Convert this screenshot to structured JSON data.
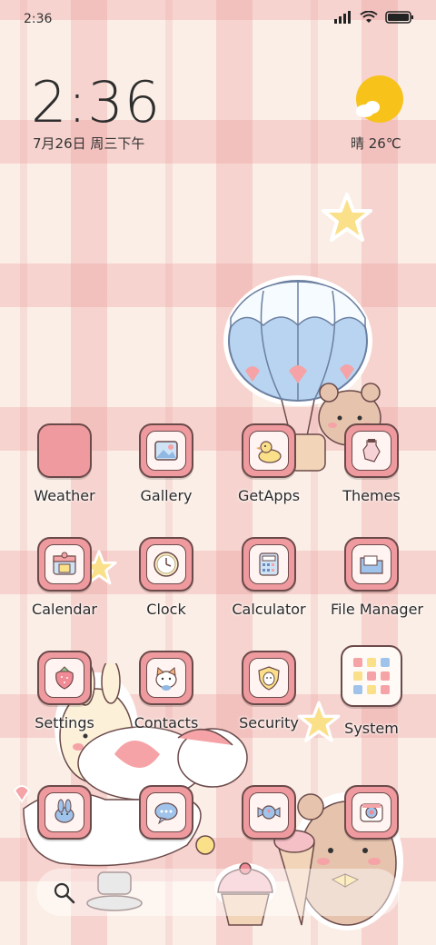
{
  "status_bar": {
    "time": "2:36",
    "icons": [
      "signal-icon",
      "wifi-icon",
      "battery-icon"
    ]
  },
  "clock_widget": {
    "time": "2:36",
    "date": "7月26日 周三下午"
  },
  "weather_widget": {
    "condition_icon": "sun-cloud-icon",
    "text": "晴 26℃"
  },
  "apps_row1": [
    {
      "label": "Weather",
      "icon": "weather-icon"
    },
    {
      "label": "Gallery",
      "icon": "picture-icon"
    },
    {
      "label": "GetApps",
      "icon": "duck-icon"
    },
    {
      "label": "Themes",
      "icon": "bottle-icon"
    }
  ],
  "apps_row2": [
    {
      "label": "Calendar",
      "icon": "calendar-icon"
    },
    {
      "label": "Clock",
      "icon": "clock-icon"
    },
    {
      "label": "Calculator",
      "icon": "calculator-icon"
    },
    {
      "label": "File Manager",
      "icon": "folder-icon"
    }
  ],
  "apps_row3": [
    {
      "label": "Settings",
      "icon": "strawberry-icon"
    },
    {
      "label": "Contacts",
      "icon": "cat-icon"
    },
    {
      "label": "Security",
      "icon": "shield-icon"
    },
    {
      "label": "System",
      "icon": "folder-grid-icon"
    }
  ],
  "dock": [
    {
      "icon": "phone-bunny-icon"
    },
    {
      "icon": "message-icon"
    },
    {
      "icon": "candy-icon"
    },
    {
      "icon": "camera-icon"
    }
  ],
  "search_bar": {
    "icon": "search-icon"
  },
  "colors": {
    "background": "#fbeee6",
    "plaid": "#eca0a0",
    "icon_pink": "#ee9a9e",
    "icon_border": "#6b4a4a",
    "sun": "#f7c21a"
  }
}
